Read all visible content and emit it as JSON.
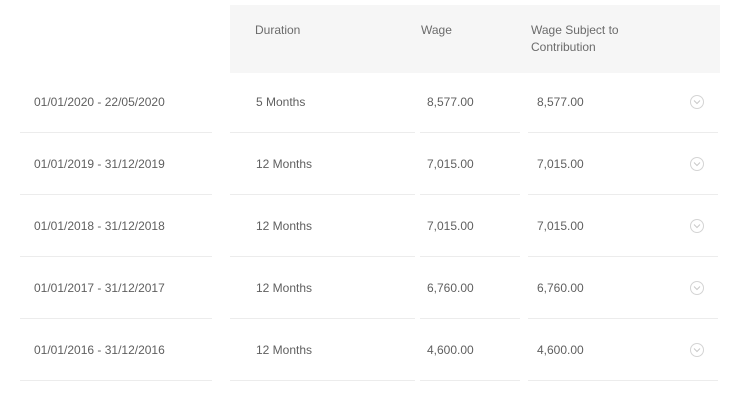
{
  "table": {
    "headers": {
      "period": "",
      "duration": "Duration",
      "wage": "Wage",
      "wage_subject": "Wage Subject to Contribution"
    },
    "rows": [
      {
        "period": "01/01/2020 - 22/05/2020",
        "duration": "5 Months",
        "wage": "8,577.00",
        "wage_subject": "8,577.00",
        "icon": "chevron-down-circle-icon"
      },
      {
        "period": "01/01/2019 - 31/12/2019",
        "duration": "12 Months",
        "wage": "7,015.00",
        "wage_subject": "7,015.00",
        "icon": "chevron-down-circle-icon"
      },
      {
        "period": "01/01/2018 - 31/12/2018",
        "duration": "12 Months",
        "wage": "7,015.00",
        "wage_subject": "7,015.00",
        "icon": "chevron-down-circle-icon"
      },
      {
        "period": "01/01/2017 - 31/12/2017",
        "duration": "12 Months",
        "wage": "6,760.00",
        "wage_subject": "6,760.00",
        "icon": "chevron-down-circle-icon"
      },
      {
        "period": "01/01/2016 - 31/12/2016",
        "duration": "12 Months",
        "wage": "4,600.00",
        "wage_subject": "4,600.00",
        "icon": "chevron-down-circle-icon"
      }
    ]
  },
  "colors": {
    "header_bg": "#f6f6f6",
    "text": "#5f5f5f",
    "divider": "#ececec",
    "icon": "#c9c9c9"
  }
}
